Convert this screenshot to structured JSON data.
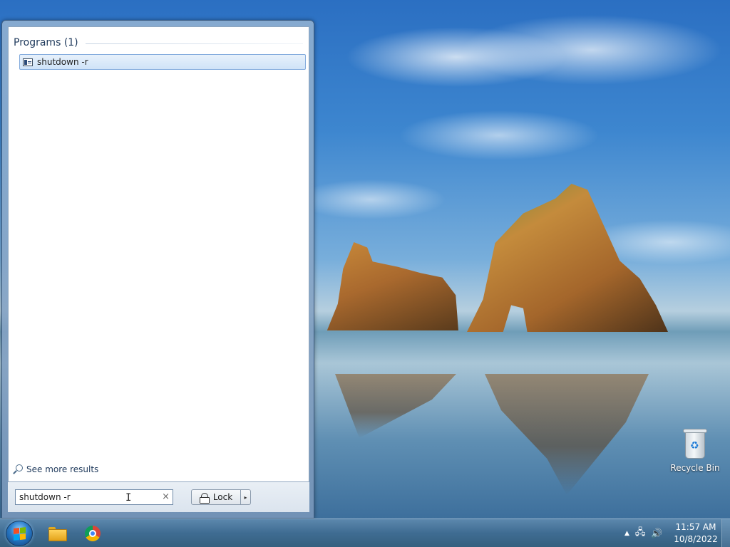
{
  "start_menu": {
    "section_title": "Programs (1)",
    "results": [
      {
        "label": "shutdown -r",
        "icon": "console-window-icon"
      }
    ],
    "see_more": "See more results",
    "search": {
      "value": "shutdown -r",
      "placeholder": "",
      "clear_glyph": "×"
    },
    "power_button": {
      "label": "Lock",
      "arrow_glyph": "▸"
    }
  },
  "desktop": {
    "icons": [
      {
        "label": "Recycle Bin",
        "icon": "recycle-bin-icon"
      }
    ]
  },
  "taskbar": {
    "pinned": [
      {
        "name": "file-explorer",
        "icon": "folder-icon"
      },
      {
        "name": "chrome",
        "icon": "chrome-icon"
      }
    ],
    "tray": {
      "overflow_glyph": "▲",
      "network_glyph": "🖧",
      "volume_glyph": "🔊"
    },
    "clock": {
      "time": "11:57 AM",
      "date": "10/8/2022"
    }
  },
  "colors": {
    "taskbar": "#3f6c92",
    "selection": "#cfe3f8",
    "selection_border": "#84acdd",
    "header_text": "#1e395b"
  }
}
